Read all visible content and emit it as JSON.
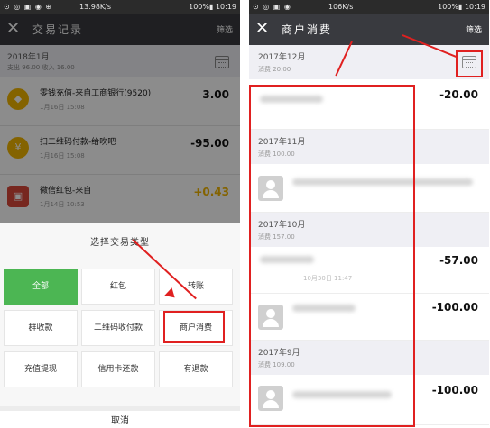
{
  "left": {
    "status": {
      "left": "⊙ ◎ ▣ ◉ ⊕",
      "mid": "13.98K/s",
      "right": "100%▮ 10:19"
    },
    "nav": {
      "close": "✕",
      "title": "交易记录",
      "filter": "筛选"
    },
    "month_header": {
      "month": "2018年1月",
      "summary": "支出 96.00 收入 16.00",
      "icon": "calendar-icon"
    },
    "items": [
      {
        "title": "零钱充值-来自工商银行(9520)",
        "date": "1月16日 15:08",
        "amount": "3.00",
        "icon_color": "#f0b400",
        "icon": "diamond-icon"
      },
      {
        "title": "扫二维码付款-给吹吧",
        "date": "1月16日 15:08",
        "amount": "-95.00",
        "icon_color": "#f0b400",
        "icon": "coin-bag-icon"
      },
      {
        "title": "微信红包-来自",
        "date": "1月14日 10:53",
        "amount": "+0.43",
        "amount_color": "#f0b400",
        "icon_color": "#d9473a",
        "icon": "red-packet-icon"
      }
    ],
    "sheet": {
      "title": "选择交易类型",
      "options": [
        "全部",
        "红包",
        "转账",
        "群收款",
        "二维码收付款",
        "商户消费",
        "充值提现",
        "信用卡还款",
        "有退款"
      ],
      "selected": "全部",
      "cancel": "取消"
    }
  },
  "right": {
    "status": {
      "left": "⊙ ◎ ▣ ◉",
      "mid": "106K/s",
      "right": "100%▮ 10:19"
    },
    "nav": {
      "close": "✕",
      "title": "商户消费",
      "filter": "筛选"
    },
    "months": [
      {
        "month": "2017年12月",
        "summary": "消费 20.00"
      },
      {
        "month": "2017年11月",
        "summary": "消费 100.00"
      },
      {
        "month": "2017年10月",
        "summary": "消费 157.00"
      },
      {
        "month": "2017年9月",
        "summary": "消费 109.00"
      }
    ],
    "amounts": [
      "-20.00",
      "-57.00",
      "-100.00",
      "-100.00"
    ],
    "timestamp": "10月30日 11:47"
  }
}
